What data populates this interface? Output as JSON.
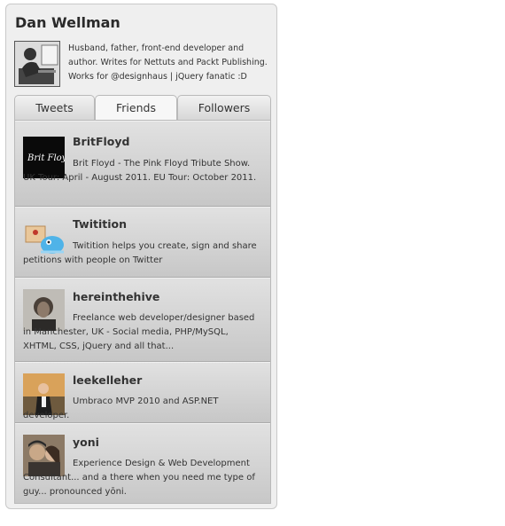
{
  "profile": {
    "name": "Dan Wellman",
    "bio": "Husband, father, front-end developer and author. Writes for Nettuts and Packt Publishing. Works for @designhaus | jQuery fanatic :D"
  },
  "tabs": [
    {
      "label": "Tweets",
      "active": false
    },
    {
      "label": "Friends",
      "active": true
    },
    {
      "label": "Followers",
      "active": false
    }
  ],
  "friends": [
    {
      "name": "BritFloyd",
      "description": "Brit Floyd - The Pink Floyd Tribute Show. UK Tour: April - August 2011. EU Tour: October 2011.",
      "avatar_icon": "britfloyd-logo",
      "logo_text": "Brit Floyd"
    },
    {
      "name": "Twitition",
      "description": "Twitition helps you create, sign and share petitions with people on Twitter",
      "avatar_icon": "twitition-bird-icon"
    },
    {
      "name": "hereinthehive",
      "description": "Freelance web developer/designer based in Manchester, UK - Social media, PHP/MySQL, XHTML, CSS, jQuery and all that...",
      "avatar_icon": "person-photo"
    },
    {
      "name": "leekelleher",
      "description": "Umbraco MVP 2010 and ASP.NET developer.",
      "avatar_icon": "person-photo"
    },
    {
      "name": "yoni",
      "description": "Experience Design & Web Development Consultant... and a there when you need me type of guy... pronounced yōni.",
      "avatar_icon": "couple-photo"
    }
  ],
  "colors": {
    "panel_bg": "#d5d5d5",
    "widget_bg": "#efefef",
    "text": "#333333"
  }
}
